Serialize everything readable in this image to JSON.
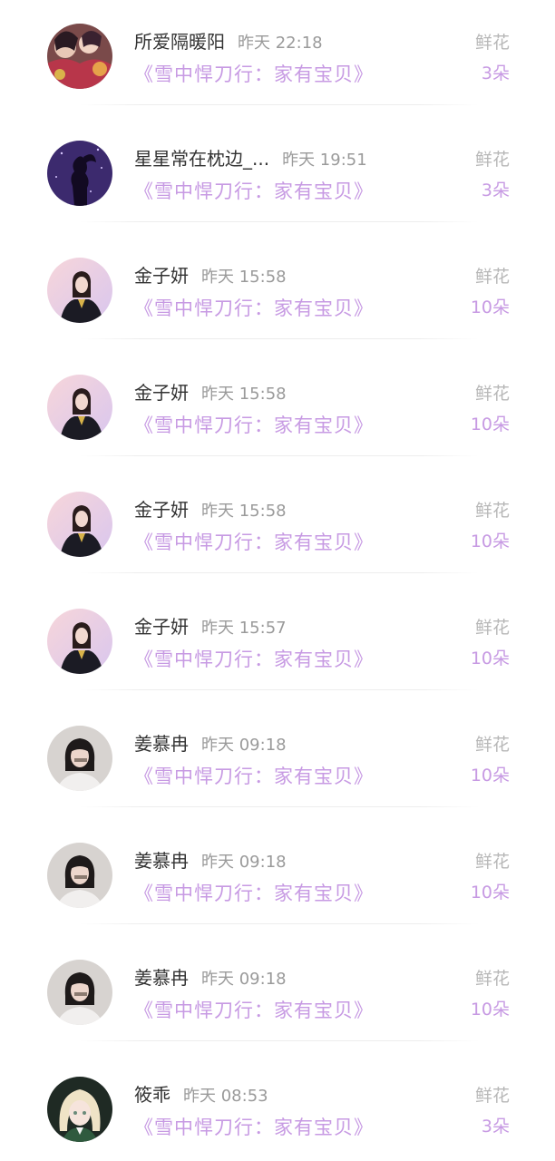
{
  "rows": [
    {
      "name": "所爱隔暖阳",
      "time": "昨天 22:18",
      "book": "《雪中悍刀行：家有宝贝》",
      "gift": "鲜花",
      "count": "3朵",
      "avatar": "anime-group-avatar"
    },
    {
      "name": "星星常在枕边_...",
      "time": "昨天 19:51",
      "book": "《雪中悍刀行：家有宝贝》",
      "gift": "鲜花",
      "count": "3朵",
      "avatar": "silhouette-night-avatar"
    },
    {
      "name": "金子妍",
      "time": "昨天 15:58",
      "book": "《雪中悍刀行：家有宝贝》",
      "gift": "鲜花",
      "count": "10朵",
      "avatar": "girl-pink-avatar"
    },
    {
      "name": "金子妍",
      "time": "昨天 15:58",
      "book": "《雪中悍刀行：家有宝贝》",
      "gift": "鲜花",
      "count": "10朵",
      "avatar": "girl-pink-avatar"
    },
    {
      "name": "金子妍",
      "time": "昨天 15:58",
      "book": "《雪中悍刀行：家有宝贝》",
      "gift": "鲜花",
      "count": "10朵",
      "avatar": "girl-pink-avatar"
    },
    {
      "name": "金子妍",
      "time": "昨天 15:57",
      "book": "《雪中悍刀行：家有宝贝》",
      "gift": "鲜花",
      "count": "10朵",
      "avatar": "girl-pink-avatar"
    },
    {
      "name": "姜慕冉",
      "time": "昨天 09:18",
      "book": "《雪中悍刀行：家有宝贝》",
      "gift": "鲜花",
      "count": "10朵",
      "avatar": "girl-gray-avatar"
    },
    {
      "name": "姜慕冉",
      "time": "昨天 09:18",
      "book": "《雪中悍刀行：家有宝贝》",
      "gift": "鲜花",
      "count": "10朵",
      "avatar": "girl-gray-avatar"
    },
    {
      "name": "姜慕冉",
      "time": "昨天 09:18",
      "book": "《雪中悍刀行：家有宝贝》",
      "gift": "鲜花",
      "count": "10朵",
      "avatar": "girl-gray-avatar"
    },
    {
      "name": "筱乖",
      "time": "昨天 08:53",
      "book": "《雪中悍刀行：家有宝贝》",
      "gift": "鲜花",
      "count": "3朵",
      "avatar": "anime-blonde-avatar"
    }
  ],
  "colors": {
    "accent": "#c79ae3",
    "name": "#333333",
    "meta": "#9a9a9a",
    "gift_label": "#b7b7b7"
  }
}
